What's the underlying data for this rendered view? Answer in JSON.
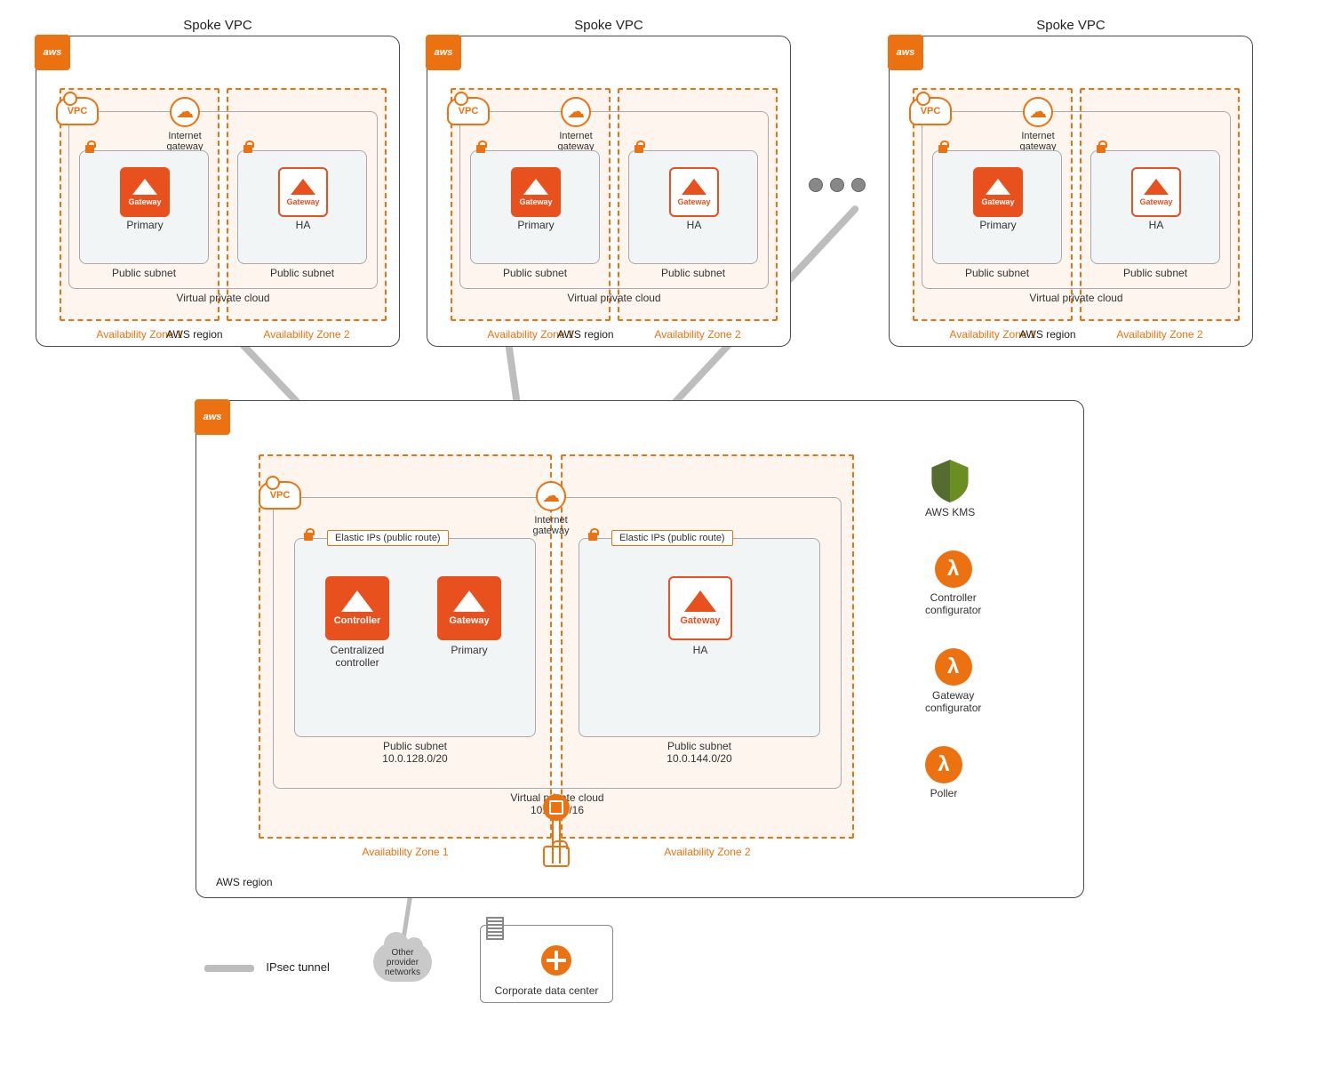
{
  "spoke1": {
    "title": "Spoke VPC",
    "region": "AWS region",
    "az1": "Availability Zone 1",
    "az2": "Availability Zone 2",
    "vpc": "Virtual private cloud",
    "igw": "Internet\ngateway",
    "subnet": "Public subnet",
    "primary": "Primary",
    "ha": "HA",
    "gw": "Gateway"
  },
  "spoke2": {
    "title": "Spoke VPC",
    "region": "AWS region",
    "az1": "Availability Zone 1",
    "az2": "Availability Zone 2",
    "vpc": "Virtual private cloud",
    "igw": "Internet\ngateway",
    "subnet": "Public subnet",
    "primary": "Primary",
    "ha": "HA",
    "gw": "Gateway"
  },
  "spoke3": {
    "title": "Spoke VPC",
    "region": "AWS region",
    "az1": "Availability Zone 1",
    "az2": "Availability Zone 2",
    "vpc": "Virtual private cloud",
    "igw": "Internet\ngateway",
    "subnet": "Public subnet",
    "primary": "Primary",
    "ha": "HA",
    "gw": "Gateway"
  },
  "hub": {
    "region": "AWS region",
    "az1": "Availability Zone 1",
    "az2": "Availability Zone 2",
    "vpc": "Virtual private cloud\n10.0.0.0/16",
    "igw": "Internet\ngateway",
    "elastic": "Elastic IPs (public route)",
    "subnet1": "Public subnet\n10.0.128.0/20",
    "subnet2": "Public subnet\n10.0.144.0/20",
    "controller": "Controller",
    "controller_label": "Centralized\ncontroller",
    "gw": "Gateway",
    "primary": "Primary",
    "ha": "HA"
  },
  "services": {
    "kms": "AWS KMS",
    "lambda1": "Controller\nconfigurator",
    "lambda2": "Gateway\nconfigurator",
    "lambda3": "Poller"
  },
  "bottom": {
    "other": "Other\nprovider\nnetworks",
    "dc": "Corporate data center"
  },
  "legend": {
    "ipsec": "IPsec tunnel"
  },
  "aws_logo": "aws"
}
